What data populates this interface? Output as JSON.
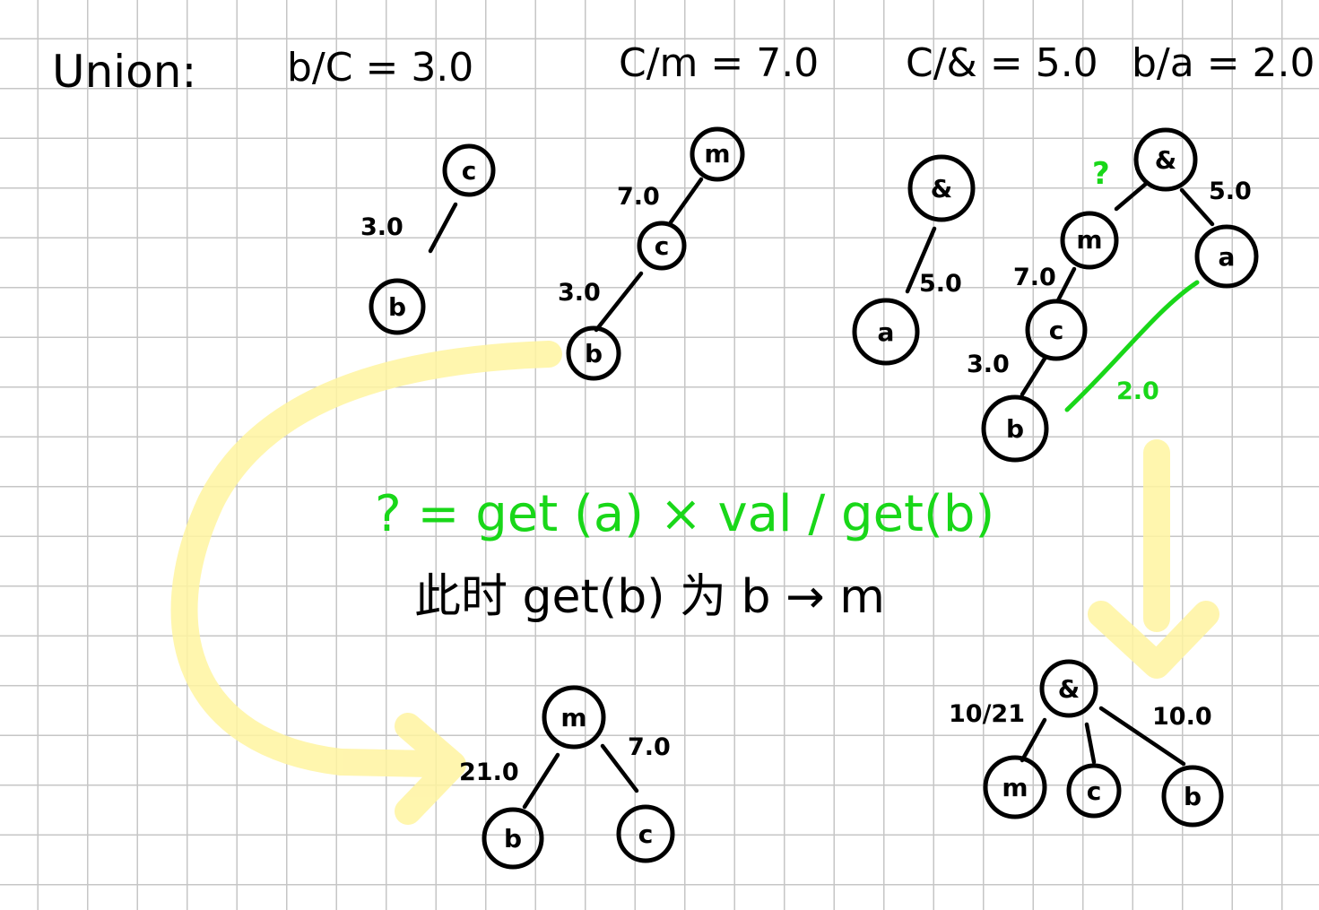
{
  "header": {
    "title": "Union:",
    "equations": [
      "b/C = 3.0",
      "C/m = 7.0",
      "C/& = 5.0",
      "b/a = 2.0"
    ]
  },
  "tree1": {
    "nodes": {
      "c": "c",
      "b": "b"
    },
    "edges": {
      "b_c": "3.0"
    }
  },
  "tree2": {
    "nodes": {
      "m": "m",
      "c": "c",
      "b": "b"
    },
    "edges": {
      "c_m": "7.0",
      "b_c": "3.0"
    }
  },
  "tree3": {
    "nodes": {
      "amp": "&",
      "a": "a"
    },
    "edges": {
      "a_amp": "5.0"
    }
  },
  "tree4": {
    "nodes": {
      "amp": "&",
      "m": "m",
      "a": "a",
      "c": "c",
      "b": "b"
    },
    "edges": {
      "m_amp": "?",
      "a_amp": "5.0",
      "c_m": "7.0",
      "b_c": "3.0",
      "b_a": "2.0"
    }
  },
  "formula": {
    "text": "? =  get (a) × val / get(b)"
  },
  "note": {
    "text": "此时 get(b) 为 b → m"
  },
  "tree5": {
    "nodes": {
      "m": "m",
      "b": "b",
      "c": "c"
    },
    "edges": {
      "b_m": "21.0",
      "c_m": "7.0"
    }
  },
  "tree6": {
    "nodes": {
      "amp": "&",
      "m": "m",
      "c": "c",
      "b": "b"
    },
    "edges": {
      "m_amp": "10/21",
      "b_amp": "10.0"
    }
  },
  "colors": {
    "ink": "#000000",
    "green": "#19d719",
    "highlight": "#fff7a8",
    "grid": "#c6c6c6"
  }
}
